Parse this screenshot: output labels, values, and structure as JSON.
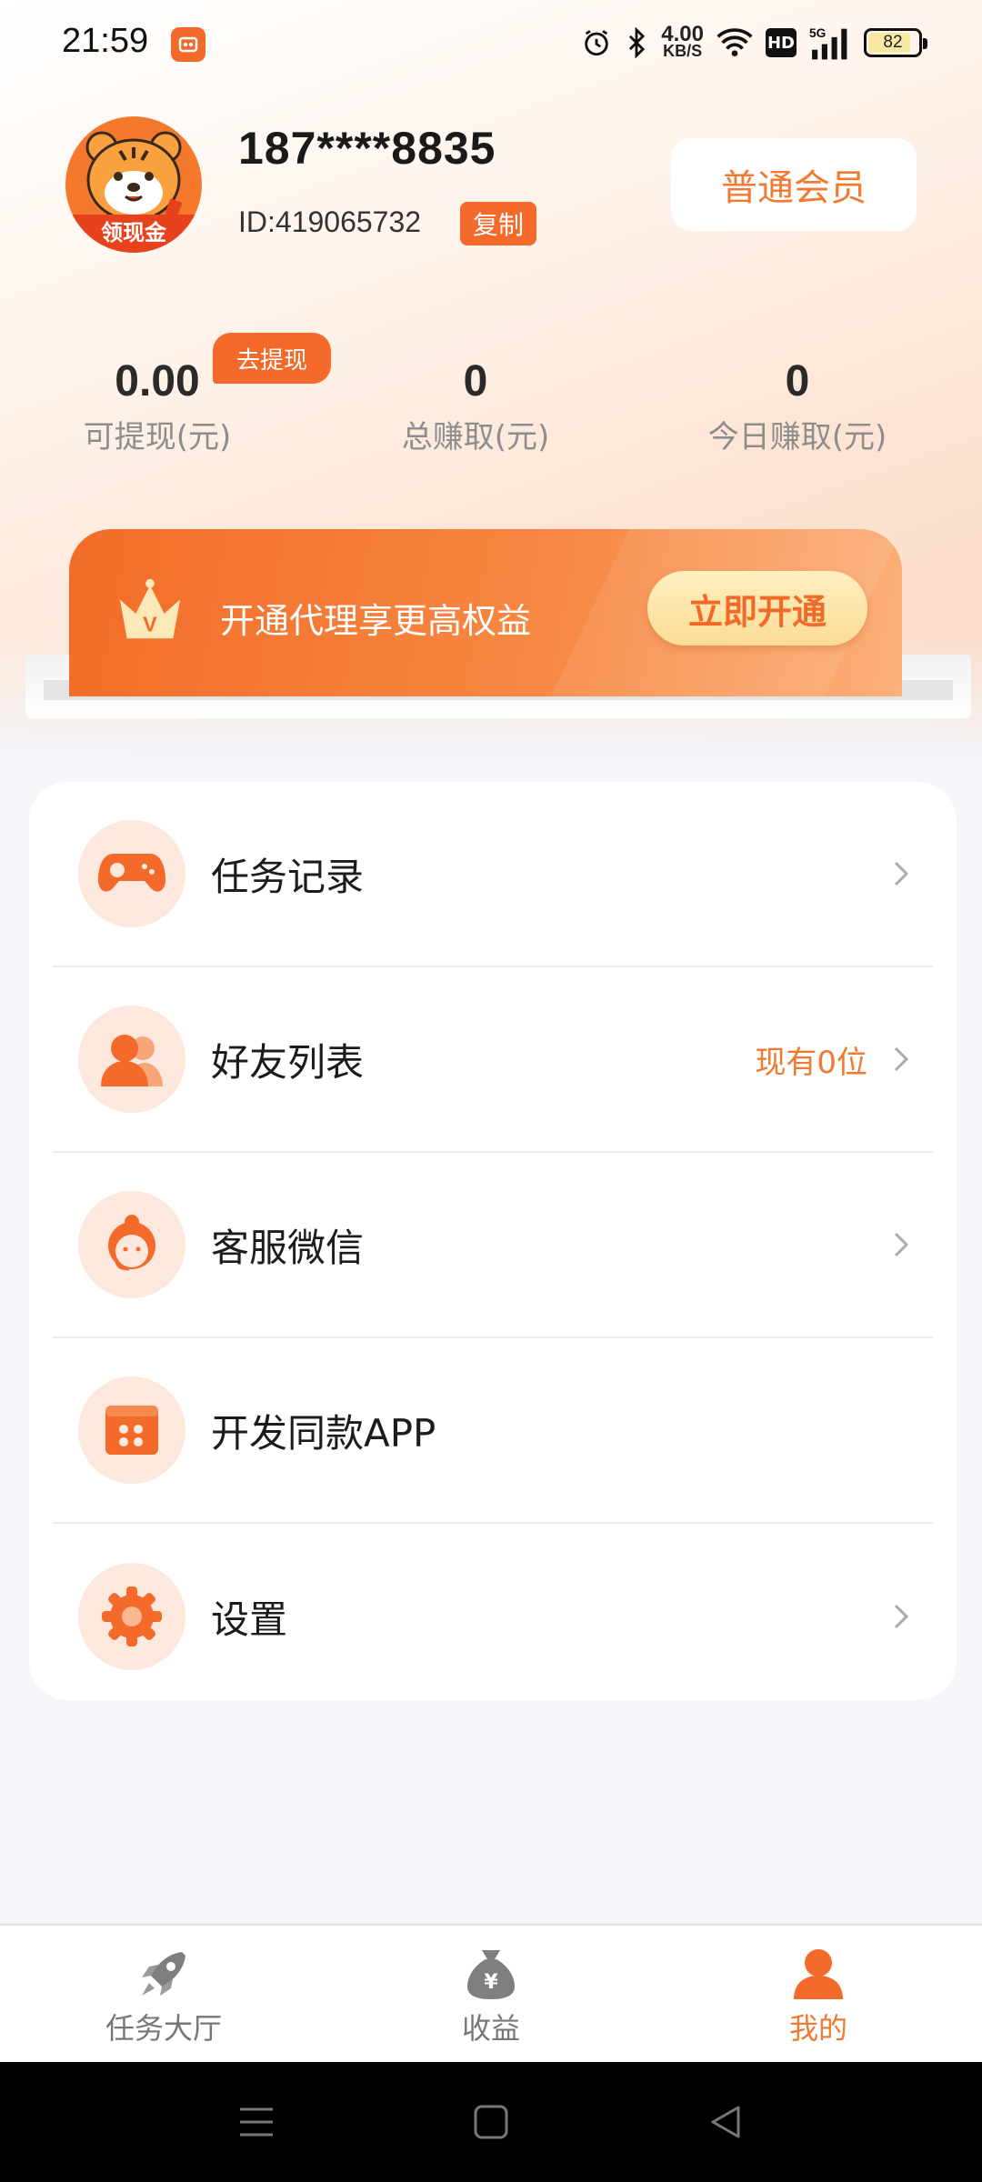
{
  "status_bar": {
    "time": "21:59",
    "speed_value": "4.00",
    "speed_unit": "KB/S",
    "hd_label": "HD",
    "network_label": "5G",
    "battery": "82"
  },
  "profile": {
    "phone": "187****8835",
    "id_text": "ID:419065732",
    "copy_label": "复制",
    "member_label": "普通会员",
    "avatar_badge": "领现金"
  },
  "stats": {
    "withdraw_tag": "去提现",
    "items": [
      {
        "value": "0.00",
        "label": "可提现(元)"
      },
      {
        "value": "0",
        "label": "总赚取(元)"
      },
      {
        "value": "0",
        "label": "今日赚取(元)"
      }
    ]
  },
  "vip_banner": {
    "crown_letter": "V",
    "text": "开通代理享更高权益",
    "button": "立即开通"
  },
  "menu": {
    "items": [
      {
        "label": "任务记录",
        "extra": "",
        "icon": "gamepad-icon"
      },
      {
        "label": "好友列表",
        "extra": "现有0位",
        "icon": "friends-icon"
      },
      {
        "label": "客服微信",
        "extra": "",
        "icon": "customer-service-icon"
      },
      {
        "label": "开发同款APP",
        "extra": "",
        "icon": "app-grid-icon"
      },
      {
        "label": "设置",
        "extra": "",
        "icon": "gear-icon"
      }
    ]
  },
  "bottom_nav": {
    "items": [
      {
        "label": "任务大厅",
        "icon": "rocket-icon"
      },
      {
        "label": "收益",
        "icon": "money-bag-icon"
      },
      {
        "label": "我的",
        "icon": "user-icon"
      }
    ],
    "active": "我的"
  },
  "colors": {
    "accent": "#f46a2a",
    "accent_text": "#f07a32",
    "icon_bg": "#fde8dd"
  }
}
